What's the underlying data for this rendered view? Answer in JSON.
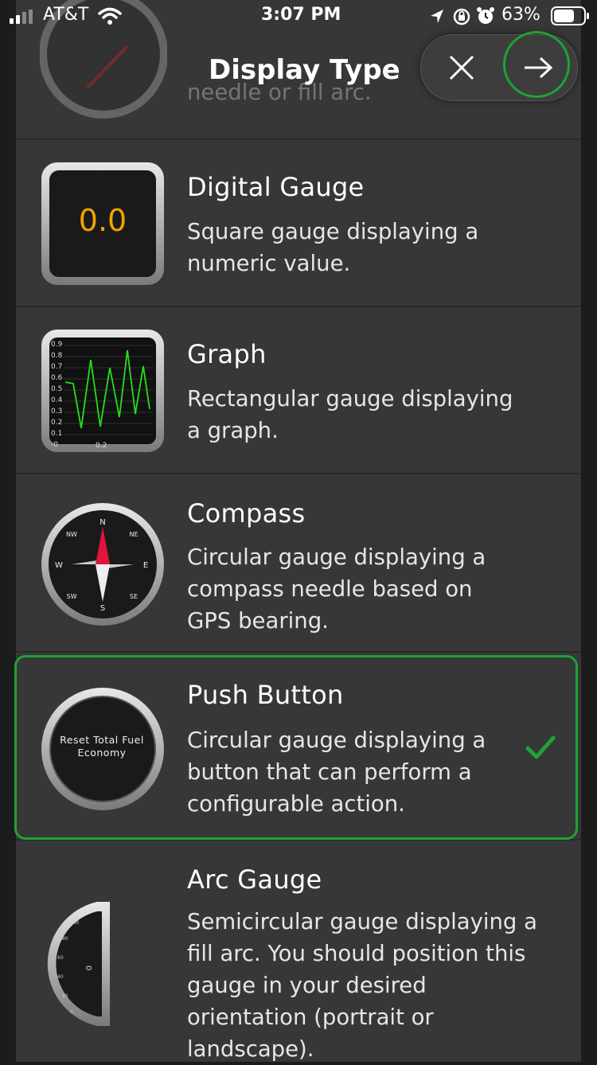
{
  "status_bar": {
    "carrier": "AT&T",
    "time": "3:07 PM",
    "battery": "63%"
  },
  "header": {
    "title": "Display Type",
    "close_icon": "close-icon",
    "next_icon": "arrow-right-icon",
    "faded_desc": "needle or fill arc."
  },
  "items": [
    {
      "title": "Digital Gauge",
      "desc": "Square gauge displaying a numeric value.",
      "icon_value": "0.0"
    },
    {
      "title": "Graph",
      "desc": "Rectangular gauge displaying a graph.",
      "ticks": [
        "0.9",
        "0.8",
        "0.7",
        "0.6",
        "0.5",
        "0.4",
        "0.3",
        "0.2",
        "0.1",
        "-0"
      ],
      "xlabel": "0.2"
    },
    {
      "title": "Compass",
      "desc": "Circular gauge displaying a compass needle based on GPS bearing.",
      "dirs": {
        "n": "N",
        "s": "S",
        "e": "E",
        "w": "W",
        "ne": "NE",
        "nw": "NW",
        "se": "SE",
        "sw": "SW"
      }
    },
    {
      "title": "Push Button",
      "desc": "Circular gauge displaying a button that can perform a configurable action.",
      "button_label": "Reset Total Fuel Economy",
      "selected": true
    },
    {
      "title": "Arc Gauge",
      "desc": "Semicircular gauge displaying a fill arc. You should position this gauge in your desired orientation (portrait or landscape).",
      "ticks": [
        "100",
        "80",
        "60",
        "40",
        "20",
        "0"
      ],
      "value": "0"
    }
  ],
  "colors": {
    "accent_green": "#1ea233",
    "digital_value": "#f0a400",
    "graph_line": "#22e01a",
    "compass_needle": "#e0143c"
  }
}
